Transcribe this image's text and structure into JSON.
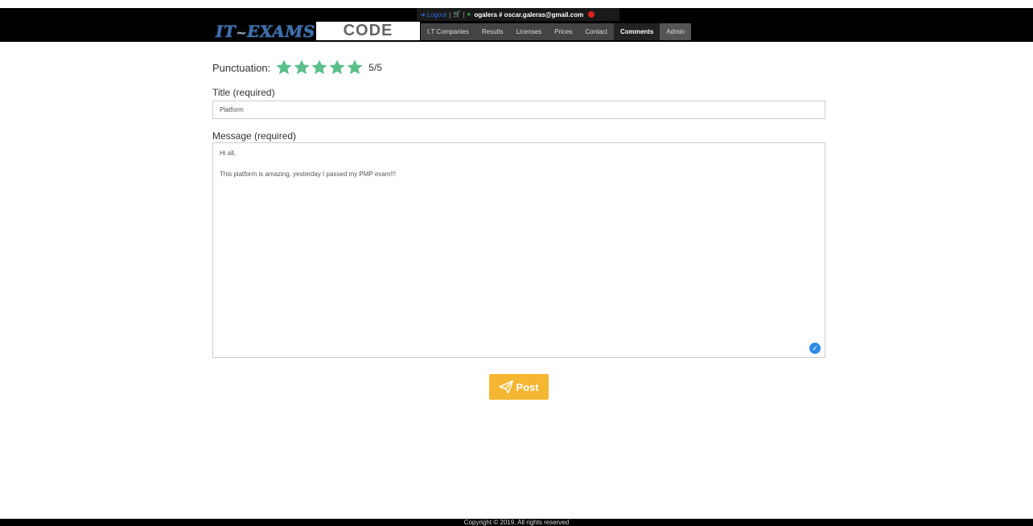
{
  "header": {
    "topbar": {
      "logout_label": "Logout",
      "separator": "|",
      "user_text": "ogalera # oscar.galeras@gmail.com"
    },
    "logo": {
      "part1": "IT",
      "tilde": "~",
      "part2": "EXAMS"
    },
    "code_label": "CODE",
    "nav": [
      {
        "label": "I.T Companies"
      },
      {
        "label": "Results"
      },
      {
        "label": "Licenses"
      },
      {
        "label": "Prices"
      },
      {
        "label": "Contact"
      },
      {
        "label": "Comments"
      },
      {
        "label": "Admin"
      }
    ],
    "active_nav": "Comments"
  },
  "form": {
    "rating_label": "Punctuation:",
    "rating": 5,
    "rating_max": 5,
    "rating_text": "5/5",
    "star_color": "#5bbf8a",
    "title_label": "Title (required)",
    "title_value": "Platform",
    "message_label": "Message (required)",
    "message_lines": [
      "Hi all,",
      "",
      "This platform is amazing, yesterday I passed my PMP exam!!!"
    ],
    "post_label": "Post"
  },
  "footer": {
    "copyright": "Copyright © 2019. All rights reserved"
  },
  "colors": {
    "accent": "#f5b731",
    "header_bg": "#000000",
    "link_blue": "#2b6fd6"
  }
}
